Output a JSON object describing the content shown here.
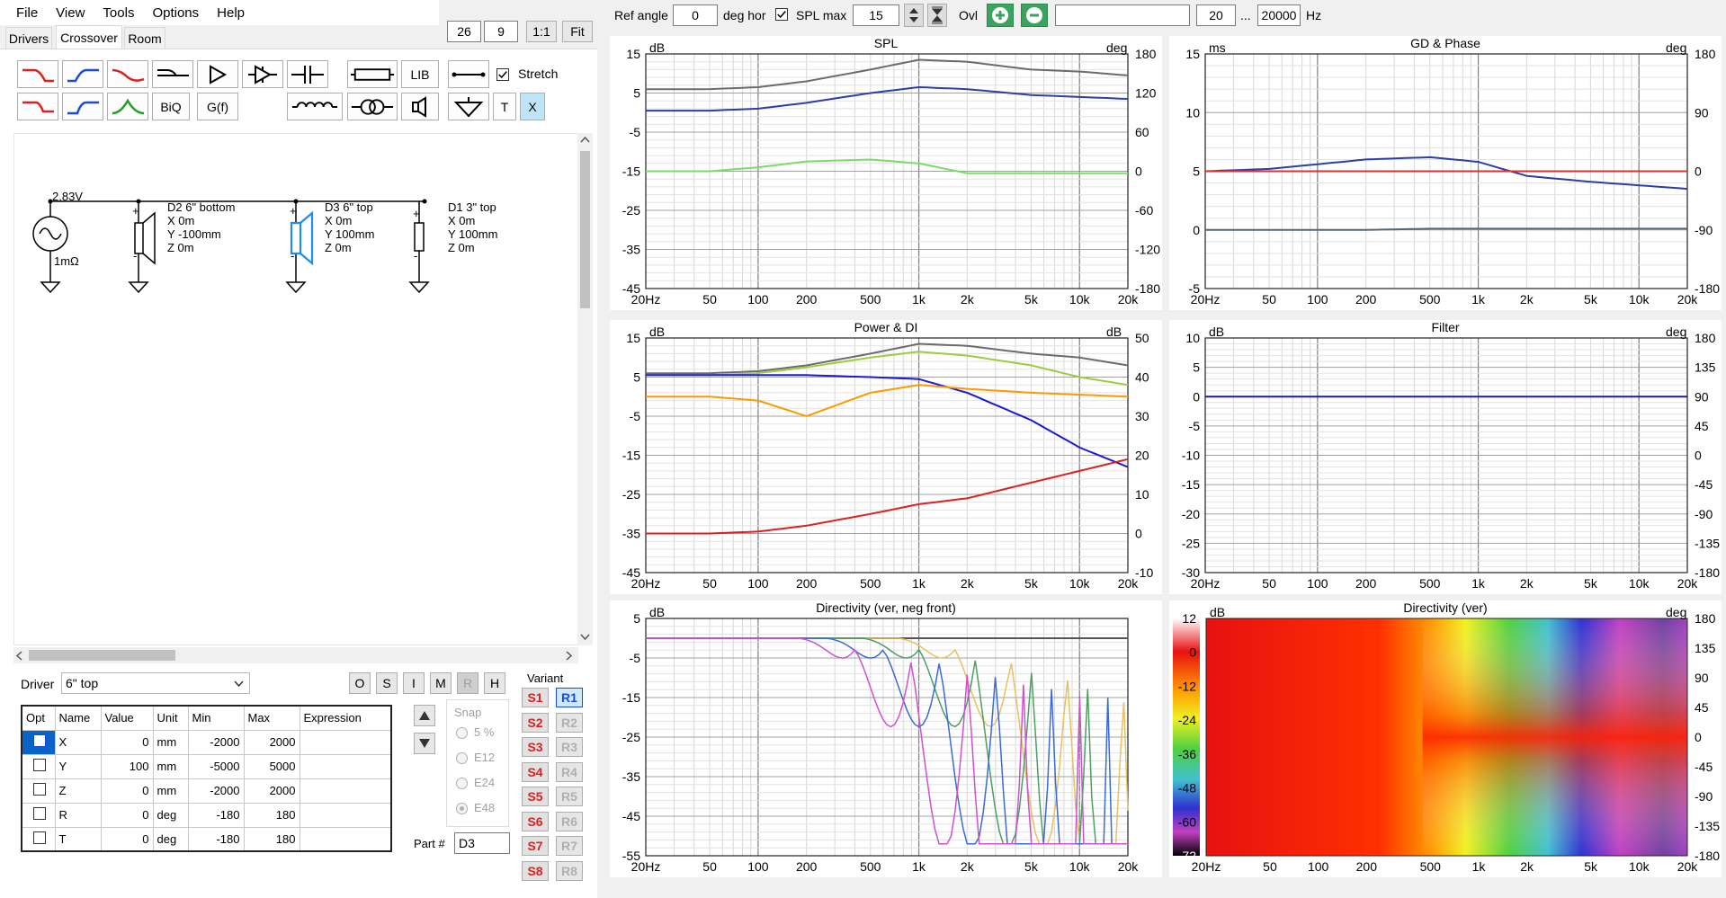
{
  "menu": [
    "File",
    "View",
    "Tools",
    "Options",
    "Help"
  ],
  "tabs": [
    "Drivers",
    "Crossover",
    "Room"
  ],
  "left_toolbar": {
    "field_a": "26",
    "field_b": "9",
    "btn_11": "1:1",
    "btn_fit": "Fit"
  },
  "tools": {
    "lib": "LIB",
    "stretch": "Stretch",
    "biq": "BiQ",
    "gf": "G(f)",
    "t": "T",
    "x": "X"
  },
  "schematic": {
    "source_voltage": "2,83V",
    "source_res": "1mΩ",
    "drivers": [
      {
        "name": "D2 6\" bottom",
        "x": "X 0m",
        "y": "Y -100mm",
        "z": "Z 0m"
      },
      {
        "name": "D3 6\" top",
        "x": "X 0m",
        "y": "Y 100mm",
        "z": "Z 0m"
      },
      {
        "name": "D1 3\" top",
        "x": "X 0m",
        "y": "Y 100mm",
        "z": "Z 0m"
      }
    ]
  },
  "driver_select": {
    "label": "Driver",
    "value": "6\" top"
  },
  "driver_buttons": [
    "O",
    "S",
    "I",
    "M",
    "R",
    "H"
  ],
  "variant_label": "Variant",
  "variants_s": [
    "S1",
    "S2",
    "S3",
    "S4",
    "S5",
    "S6",
    "S7",
    "S8"
  ],
  "variants_r": [
    "R1",
    "R2",
    "R3",
    "R4",
    "R5",
    "R6",
    "R7",
    "R8"
  ],
  "params": {
    "headers": [
      "Opt",
      "Name",
      "Value",
      "Unit",
      "Min",
      "Max",
      "Expression"
    ],
    "rows": [
      [
        "",
        "X",
        "0",
        "mm",
        "-2000",
        "2000",
        ""
      ],
      [
        "",
        "Y",
        "100",
        "mm",
        "-5000",
        "5000",
        ""
      ],
      [
        "",
        "Z",
        "0",
        "mm",
        "-2000",
        "2000",
        ""
      ],
      [
        "",
        "R",
        "0",
        "deg",
        "-180",
        "180",
        ""
      ],
      [
        "",
        "T",
        "0",
        "deg",
        "-180",
        "180",
        ""
      ]
    ]
  },
  "snap": {
    "label": "Snap",
    "options": [
      "5 %",
      "E12",
      "E24",
      "E48"
    ],
    "selected": "E48"
  },
  "part": {
    "label": "Part #",
    "value": "D3"
  },
  "topbar": {
    "ref_angle_label": "Ref angle",
    "ref_angle": "0",
    "deg_hor": "deg hor",
    "spl_max_label": "SPL max",
    "spl_max": "15",
    "ovl": "Ovl",
    "freq_min": "20",
    "dots": "...",
    "freq_max": "20000",
    "hz": "Hz"
  },
  "freq_ticks": [
    "20Hz",
    "50",
    "100",
    "200",
    "500",
    "1k",
    "2k",
    "5k",
    "10k",
    "20k"
  ],
  "panels": [
    {
      "title": "SPL",
      "lunit": "dB",
      "runit": "deg",
      "left": [
        "15",
        "5",
        "-5",
        "-15",
        "-25",
        "-35",
        "-45"
      ],
      "right": [
        "180",
        "120",
        "60",
        "0",
        "-60",
        "-120",
        "-180"
      ]
    },
    {
      "title": "GD & Phase",
      "lunit": "ms",
      "runit": "deg",
      "left": [
        "15",
        "10",
        "5",
        "0",
        "-5"
      ],
      "right": [
        "180",
        "90",
        "0",
        "-90",
        "-180"
      ]
    },
    {
      "title": "Power & DI",
      "lunit": "dB",
      "runit": "dB",
      "left": [
        "15",
        "5",
        "-5",
        "-15",
        "-25",
        "-35",
        "-45"
      ],
      "right": [
        "50",
        "40",
        "30",
        "20",
        "10",
        "0",
        "-10"
      ]
    },
    {
      "title": "Filter",
      "lunit": "dB",
      "runit": "deg",
      "left": [
        "10",
        "5",
        "0",
        "-5",
        "-10",
        "-15",
        "-20",
        "-25",
        "-30"
      ],
      "right": [
        "180",
        "135",
        "90",
        "45",
        "0",
        "-45",
        "-90",
        "-135",
        "-180"
      ]
    },
    {
      "title": "Directivity (ver, neg front)",
      "lunit": "dB",
      "runit": "",
      "left": [
        "5",
        "-5",
        "-15",
        "-25",
        "-35",
        "-45",
        "-55"
      ],
      "right": []
    },
    {
      "title": "Directivity (ver)",
      "lunit": "dB",
      "runit": "deg",
      "left": [],
      "right": [
        "180",
        "135",
        "90",
        "45",
        "0",
        "-45",
        "-90",
        "-135",
        "-180"
      ],
      "scale": [
        "12",
        "0",
        "-12",
        "-24",
        "-36",
        "-48",
        "-60",
        "-72"
      ]
    }
  ],
  "chart_data": [
    {
      "type": "line",
      "title": "SPL",
      "x": [
        20,
        50,
        100,
        200,
        500,
        1000,
        2000,
        5000,
        10000,
        20000
      ],
      "ylim": [
        -45,
        15
      ],
      "series": [
        {
          "color": "#6b6b6b",
          "values": [
            6,
            6,
            6.5,
            8,
            11,
            13.5,
            13,
            11,
            10.5,
            9.5
          ]
        },
        {
          "color": "#2a3fa8",
          "values": [
            0.5,
            0.5,
            1,
            2.5,
            5,
            6.5,
            6,
            4.5,
            4,
            3.5
          ]
        },
        {
          "color": "#77dd66",
          "values": [
            -15,
            -15,
            -14,
            -12.5,
            -12,
            -13,
            -15.5,
            -15.5,
            -15.5,
            -15.5
          ]
        }
      ]
    },
    {
      "type": "line",
      "title": "GD & Phase",
      "x": [
        20,
        50,
        100,
        200,
        500,
        1000,
        2000,
        5000,
        10000,
        20000
      ],
      "ylim": [
        -5,
        15
      ],
      "series": [
        {
          "color": "#2a3fa8",
          "values": [
            5,
            5.2,
            5.6,
            6,
            6.2,
            5.8,
            4.6,
            4.1,
            3.8,
            3.5
          ]
        },
        {
          "color": "#e03030",
          "values": [
            5,
            5,
            5,
            5,
            5,
            5,
            5,
            5,
            5,
            5
          ]
        },
        {
          "color": "#556677",
          "values": [
            0,
            0,
            0,
            0,
            0.1,
            0.1,
            0.1,
            0.1,
            0.1,
            0.1
          ]
        }
      ]
    },
    {
      "type": "line",
      "title": "Power & DI",
      "x": [
        20,
        50,
        100,
        200,
        500,
        1000,
        2000,
        5000,
        10000,
        20000
      ],
      "ylim": [
        -45,
        15
      ],
      "series": [
        {
          "color": "#6b6b6b",
          "values": [
            6,
            6,
            6.5,
            8,
            11,
            13.5,
            13,
            11,
            10,
            8
          ]
        },
        {
          "color": "#9ccc44",
          "values": [
            5.5,
            5.5,
            6,
            7.5,
            10,
            11.5,
            10.5,
            8,
            5,
            3
          ]
        },
        {
          "color": "#1a1ad8",
          "values": [
            5.5,
            5.5,
            5.5,
            5.5,
            5,
            4.5,
            1,
            -6,
            -13,
            -18
          ]
        },
        {
          "color": "#ff9900",
          "values": [
            0,
            0,
            -1,
            -5,
            1,
            3,
            2,
            1,
            0.5,
            0
          ]
        },
        {
          "color": "#e02020",
          "values": [
            -35,
            -35,
            -34.5,
            -33,
            -30,
            -27.5,
            -26,
            -22,
            -19,
            -16
          ]
        }
      ]
    },
    {
      "type": "line",
      "title": "Filter",
      "x": [
        20,
        20000
      ],
      "ylim": [
        -30,
        10
      ],
      "series": [
        {
          "color": "#1a1aa0",
          "values": [
            0,
            0
          ]
        }
      ]
    },
    {
      "type": "line",
      "title": "Directivity (ver, neg front)",
      "x": [
        20,
        20000
      ],
      "ylim": [
        -55,
        5
      ],
      "series": [
        {
          "color": "#555555",
          "values": [
            0,
            0
          ]
        }
      ]
    },
    {
      "type": "heatmap",
      "title": "Directivity (ver)",
      "x": [
        20,
        20000
      ],
      "ylim": [
        -180,
        180
      ]
    }
  ]
}
